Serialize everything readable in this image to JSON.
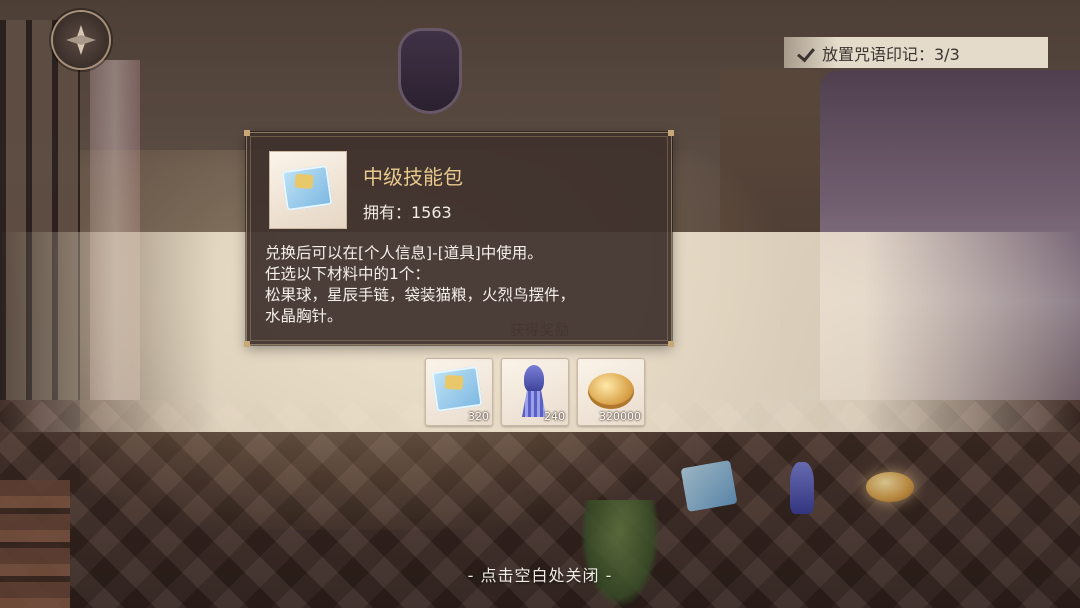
{
  "nav": {
    "icon": "compass-icon"
  },
  "marker": {
    "text": "放置咒语印记：3/3",
    "icon": "check-icon"
  },
  "popup": {
    "name": "中级技能包",
    "owned": "拥有：1563",
    "desc_lines": [
      "兑换后可以在[个人信息]-[道具]中使用。",
      "任选以下材料中的1个：",
      "松果球，星辰手链，袋装猫粮，火烈鸟摆件，",
      "水晶胸针。"
    ]
  },
  "rewards": {
    "title": "获得奖励",
    "items": [
      {
        "name": "skill-pack-icon",
        "qty": "320"
      },
      {
        "name": "tassel-charm-icon",
        "qty": "240"
      },
      {
        "name": "gold-coin-icon",
        "qty": "320000"
      }
    ]
  },
  "footer": {
    "close_hint": "- 点击空白处关闭 -"
  },
  "colors": {
    "accent": "#e8c98e",
    "popup_bg": "#3e302c",
    "band": "#fff4de"
  }
}
